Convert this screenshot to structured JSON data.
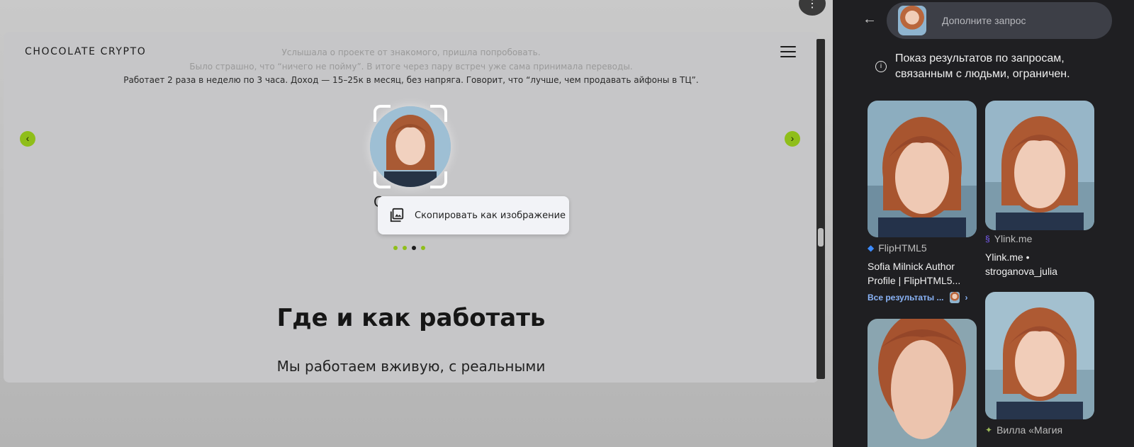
{
  "site": {
    "brand": "CHOCOLATE CRYPTO",
    "review_line_1": "Услышала о проекте от знакомого, пришла попробовать.",
    "review_line_2": "Было страшно, что “ничего не пойму”. В итоге через пару встреч уже сама принимала переводы.",
    "review_line_3": "Работает 2 раза в неделю по 3 часа. Доход — 15–25к в месяц, без напряга. Говорит, что “лучше, чем продавать айфоны в ТЦ”.",
    "prev_arrow": "‹",
    "next_arrow": "›",
    "name_partial": "С",
    "heading": "Где и как работать",
    "paragraph": "Мы работаем вживую, с реальными",
    "slider_dots": [
      false,
      false,
      true,
      false
    ]
  },
  "context_menu": {
    "item_label": "Скопировать как изображение"
  },
  "toolbar": {
    "menu_glyph": "⋮"
  },
  "lens": {
    "search_placeholder": "Дополните запрос",
    "notice": "Показ результатов по запросам, связанным с людьми, ограничен.",
    "results": [
      {
        "source": "FlipHTML5",
        "title": "Sofia Milnick Author Profile | FlipHTML5..."
      },
      {
        "source": "Ylink.me",
        "title": "Ylink.me • stroganova_julia"
      },
      {
        "source": "Вилла «Магия",
        "title": ""
      }
    ],
    "more_results": "Все результаты ..."
  },
  "colors": {
    "accent_green": "#8fbe1a",
    "panel_bg": "#1f1f22",
    "link_blue": "#8ab4f8"
  }
}
